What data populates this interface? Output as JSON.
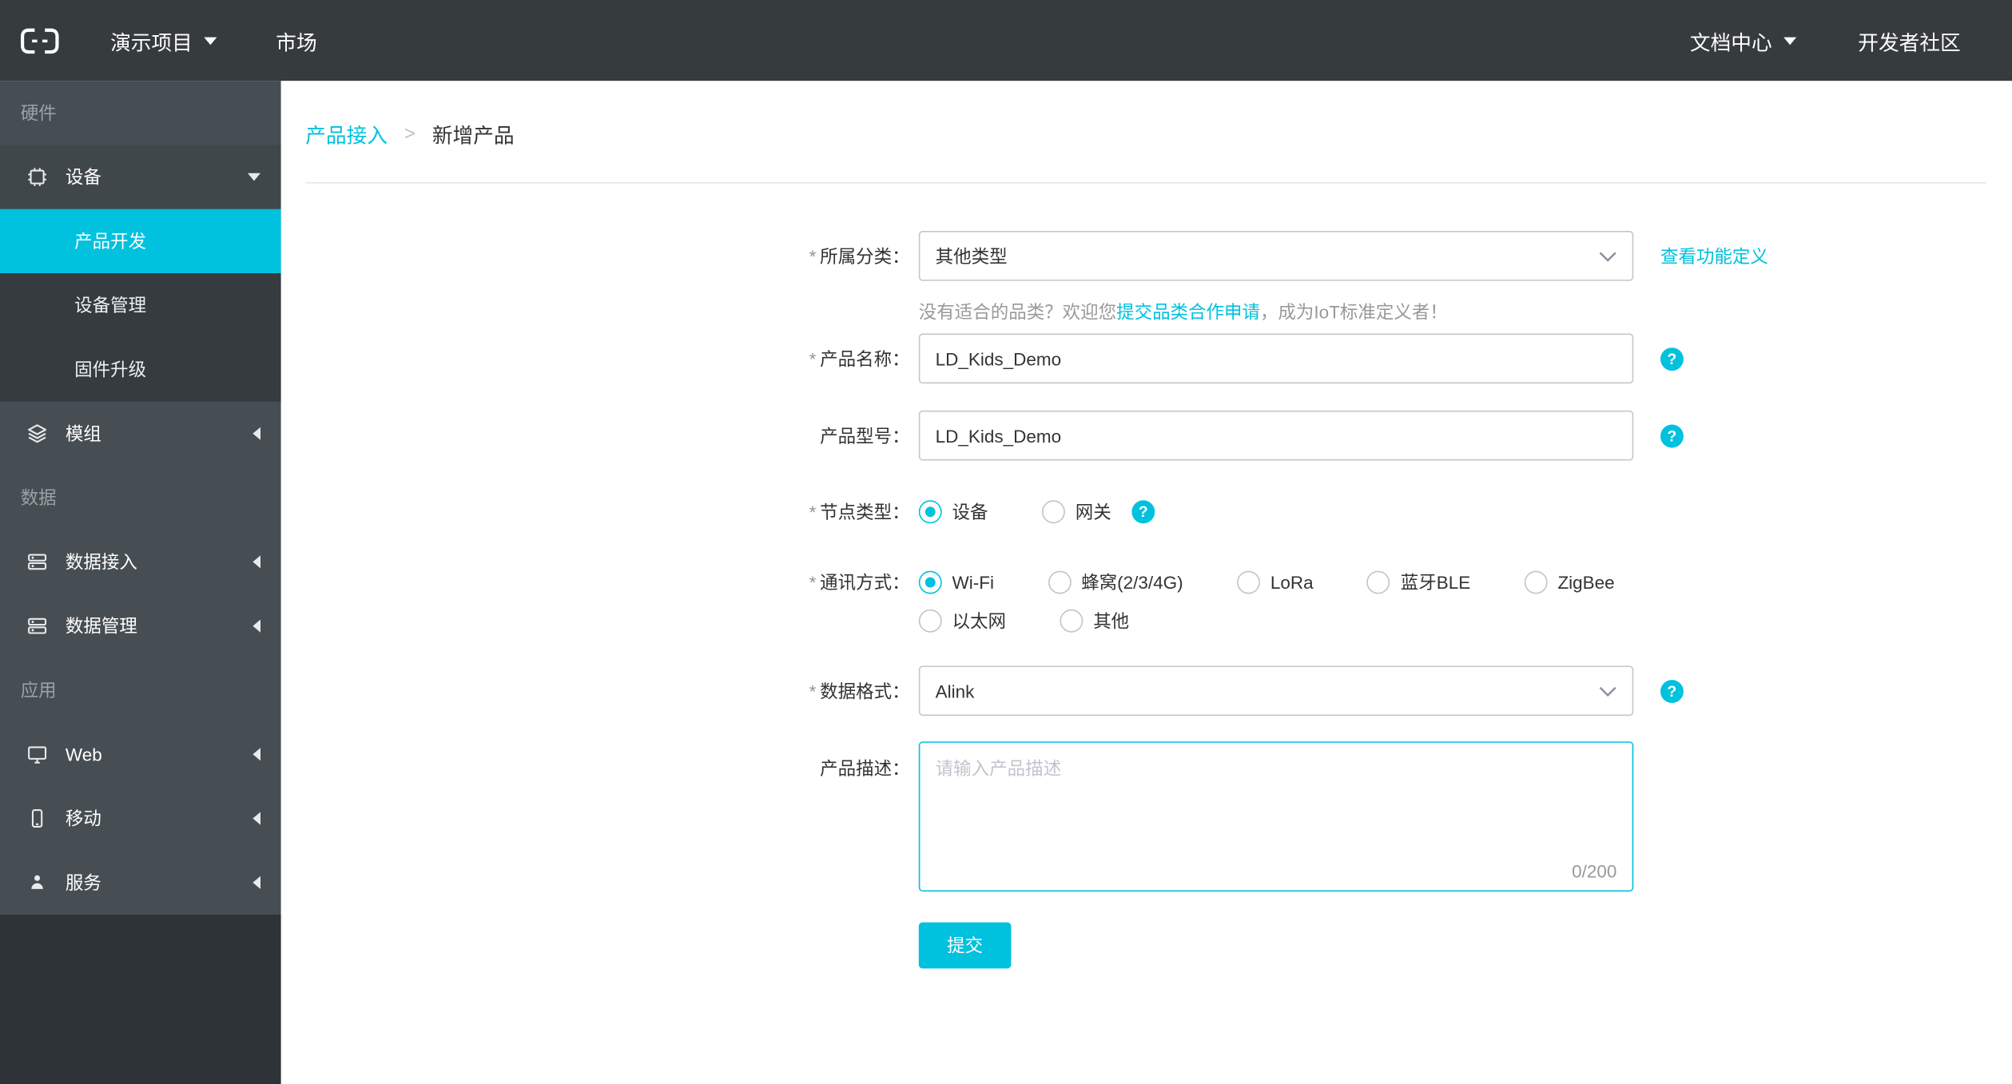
{
  "topbar": {
    "project": "演示项目",
    "market": "市场",
    "doc_center": "文档中心",
    "dev_community": "开发者社区"
  },
  "sidebar": {
    "sections": {
      "hardware": "硬件",
      "data": "数据",
      "app": "应用"
    },
    "items": {
      "device": "设备",
      "product_dev": "产品开发",
      "device_mgmt": "设备管理",
      "firmware_upgrade": "固件升级",
      "module": "模组",
      "data_access": "数据接入",
      "data_mgmt": "数据管理",
      "web": "Web",
      "mobile": "移动",
      "service": "服务"
    }
  },
  "breadcrumb": {
    "root": "产品接入",
    "separator": ">",
    "current": "新增产品"
  },
  "form": {
    "required_mark": "*",
    "help_mark": "?",
    "category": {
      "label": "所属分类：",
      "value": "其他类型",
      "action_link": "查看功能定义"
    },
    "category_hint": {
      "prefix": "没有适合的品类？欢迎您",
      "link": "提交品类合作申请",
      "suffix": "，成为IoT标准定义者！"
    },
    "product_name": {
      "label": "产品名称：",
      "value": "LD_Kids_Demo"
    },
    "product_model": {
      "label": "产品型号：",
      "value": "LD_Kids_Demo"
    },
    "node_type": {
      "label": "节点类型：",
      "options": [
        "设备",
        "网关"
      ],
      "selected": "设备"
    },
    "comm_type": {
      "label": "通讯方式：",
      "options": [
        "Wi-Fi",
        "蜂窝(2/3/4G)",
        "LoRa",
        "蓝牙BLE",
        "ZigBee",
        "以太网",
        "其他"
      ],
      "selected": "Wi-Fi"
    },
    "data_format": {
      "label": "数据格式：",
      "value": "Alink"
    },
    "description": {
      "label": "产品描述：",
      "placeholder": "请输入产品描述",
      "counter": "0/200"
    },
    "submit": "提交"
  },
  "colors": {
    "accent": "#00C1DE",
    "topbar_bg": "#363B3E",
    "sidebar_bg": "#474E53",
    "sidebar_submenu_bg": "#353B3F",
    "sidebar_bottom_bg": "#2E3337"
  }
}
